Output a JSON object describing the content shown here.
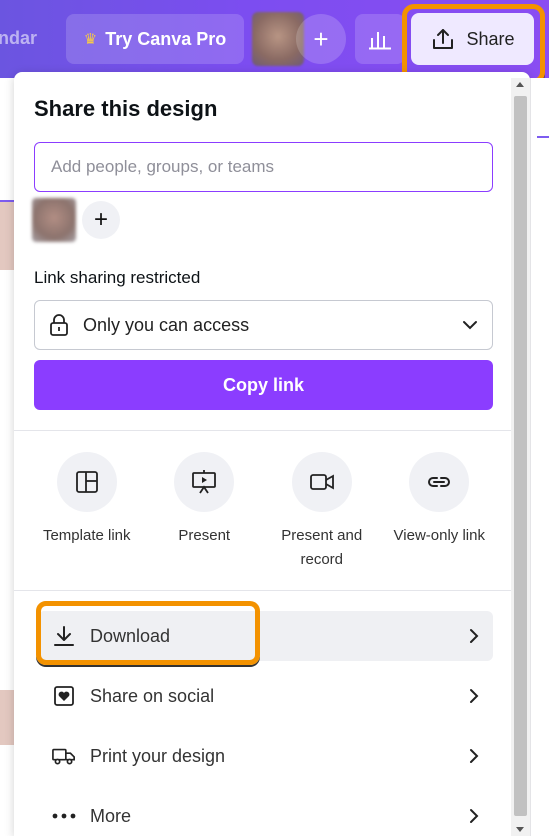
{
  "topbar": {
    "calendar_fragment": "ndar",
    "try_pro_label": "Try Canva Pro",
    "share_label": "Share"
  },
  "share_panel": {
    "title": "Share this design",
    "search_placeholder": "Add people, groups, or teams",
    "link_sharing_label": "Link sharing restricted",
    "access_value": "Only you can access",
    "copy_link_label": "Copy link",
    "options": [
      {
        "label": "Template link",
        "icon": "template-icon"
      },
      {
        "label": "Present",
        "icon": "present-icon"
      },
      {
        "label": "Present and record",
        "icon": "camera-icon"
      },
      {
        "label": "View-only link",
        "icon": "link-icon"
      }
    ],
    "actions": [
      {
        "label": "Download",
        "icon": "download-icon"
      },
      {
        "label": "Share on social",
        "icon": "heart-icon"
      },
      {
        "label": "Print your design",
        "icon": "truck-icon"
      },
      {
        "label": "More",
        "icon": "more-icon"
      }
    ]
  },
  "colors": {
    "brand_purple": "#8b3dff",
    "highlight_orange": "#f39200",
    "topbar_gradient_start": "#6b55e0"
  }
}
